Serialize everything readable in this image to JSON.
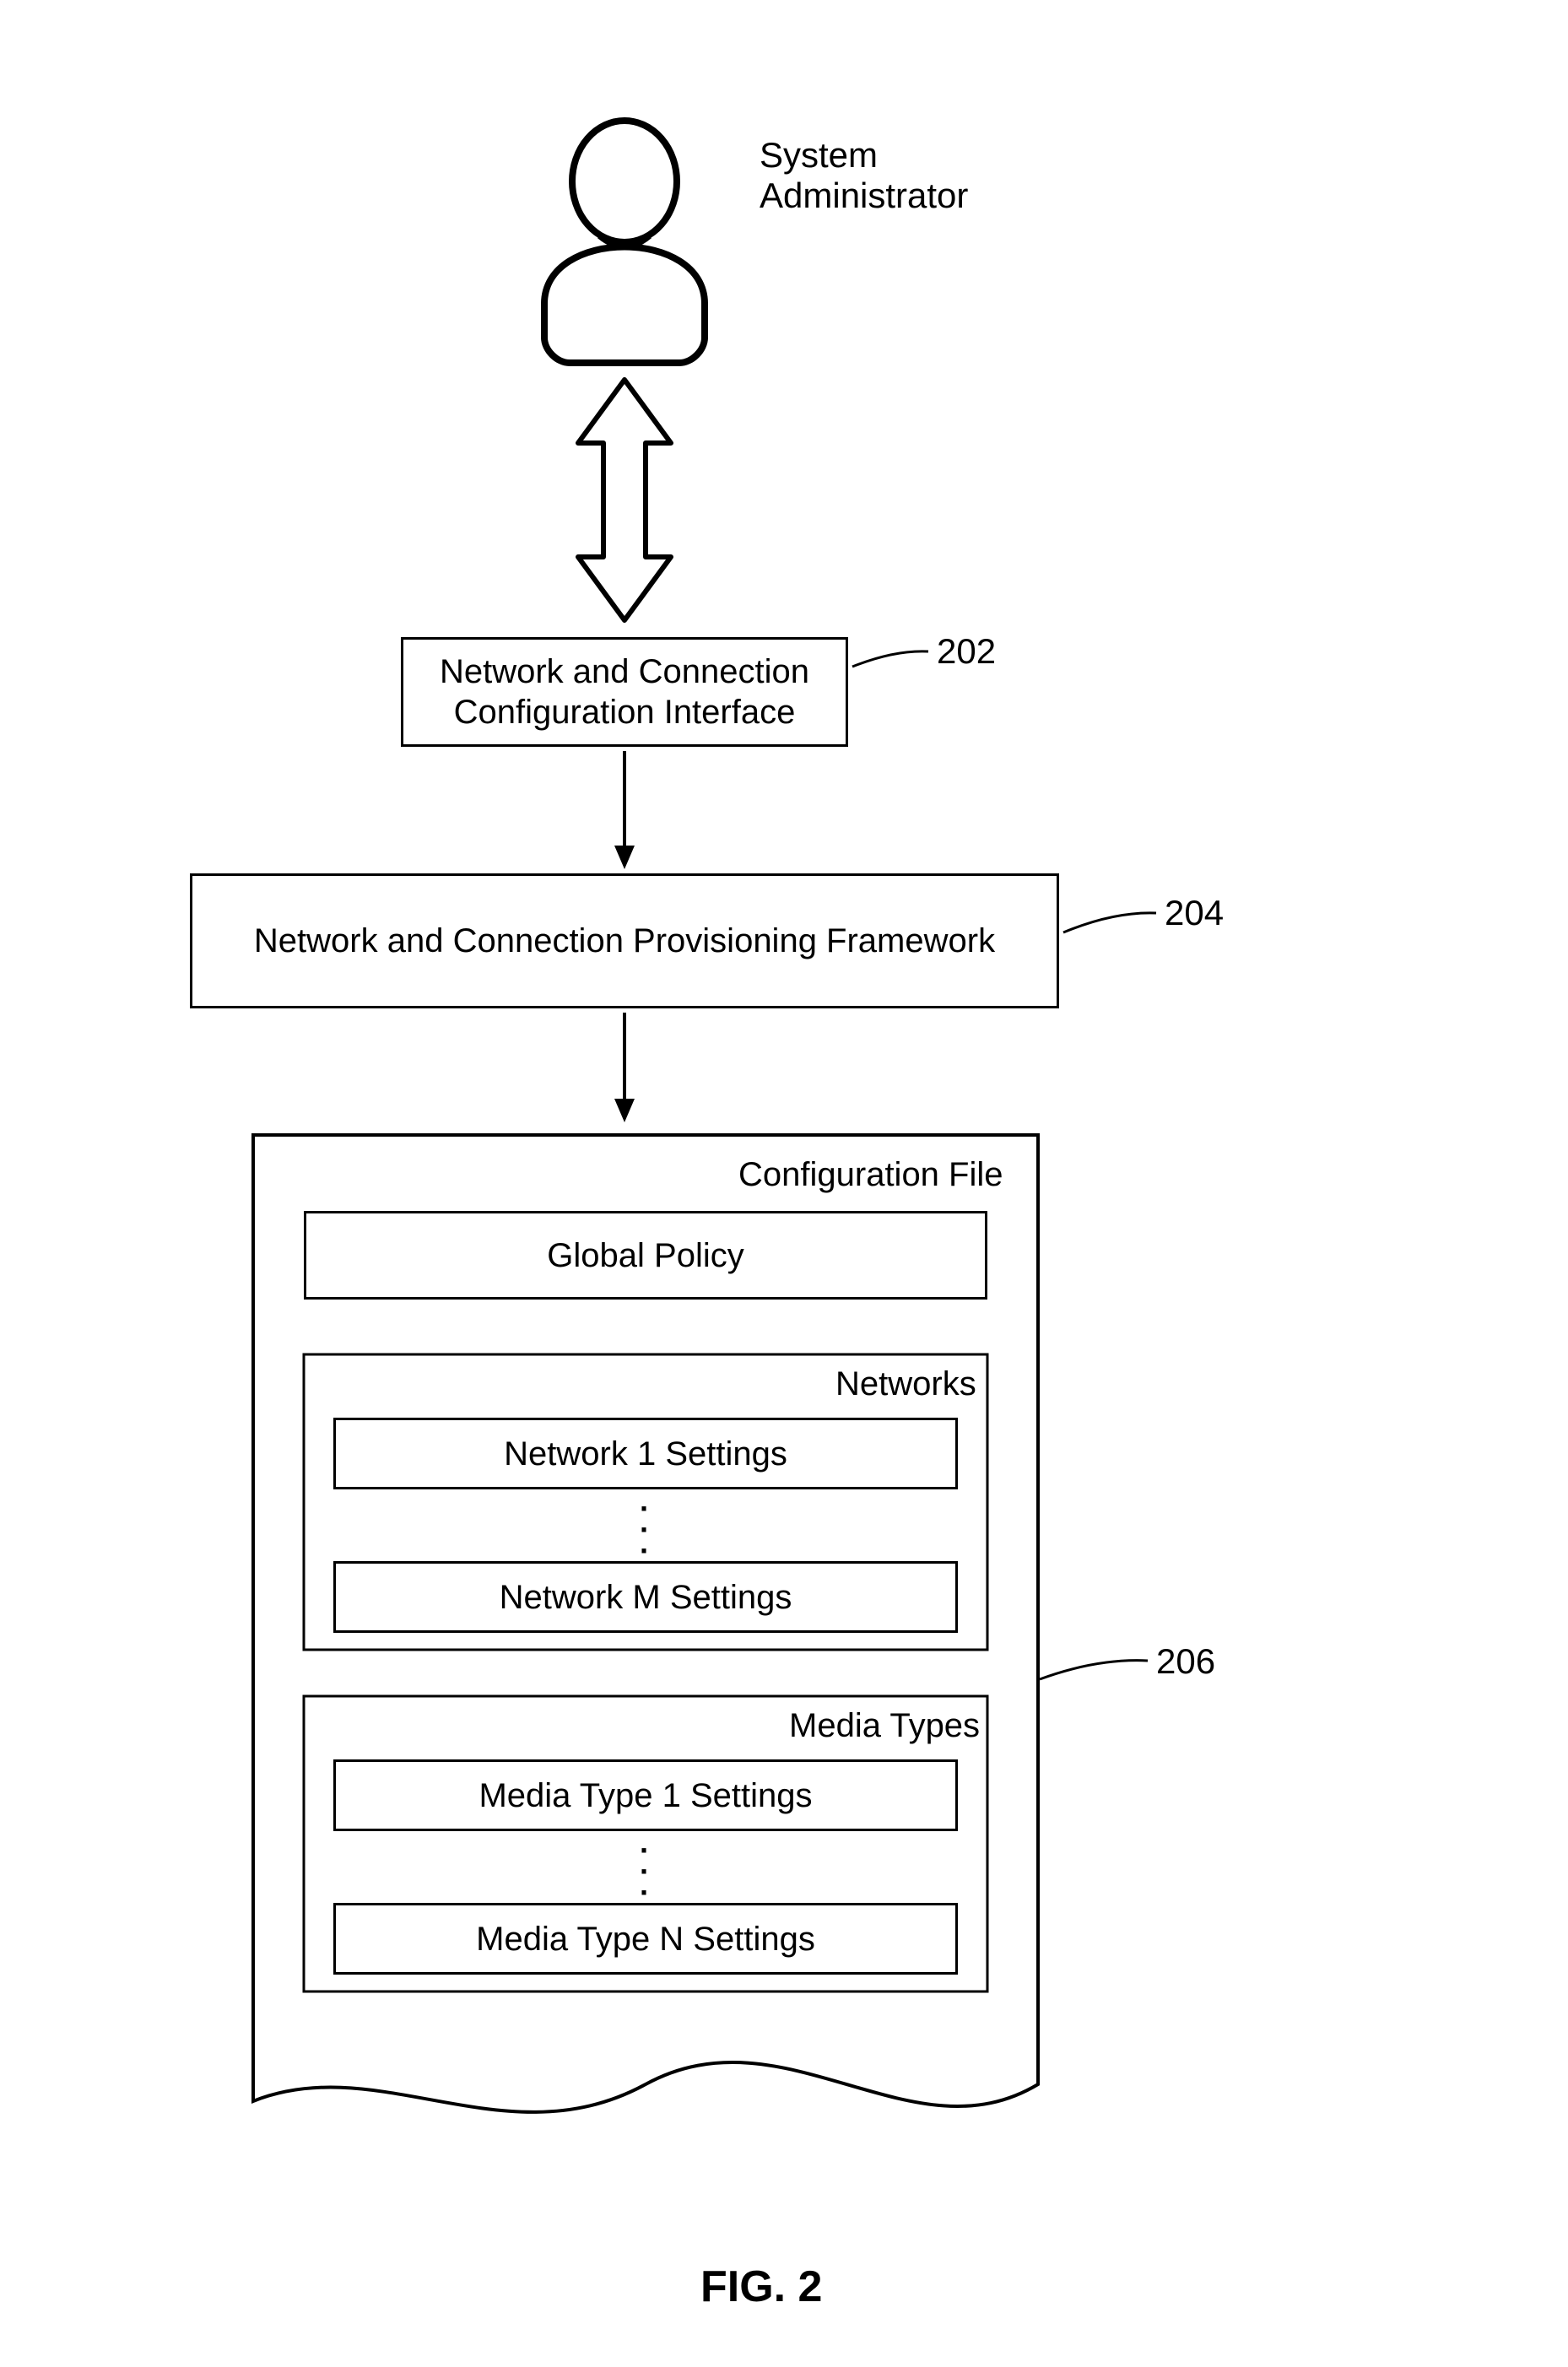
{
  "actor": {
    "label": "System\nAdministrator"
  },
  "boxes": {
    "config_interface": "Network and Connection\nConfiguration Interface",
    "provisioning_framework": "Network and Connection Provisioning Framework",
    "global_policy": "Global Policy",
    "network_first": "Network 1 Settings",
    "network_last": "Network M Settings",
    "media_first": "Media Type 1 Settings",
    "media_last": "Media Type N Settings"
  },
  "sections": {
    "config_file": "Configuration File",
    "networks": "Networks",
    "media_types": "Media Types"
  },
  "refs": {
    "config_interface": "202",
    "provisioning_framework": "204",
    "config_file": "206"
  },
  "caption": "FIG. 2"
}
